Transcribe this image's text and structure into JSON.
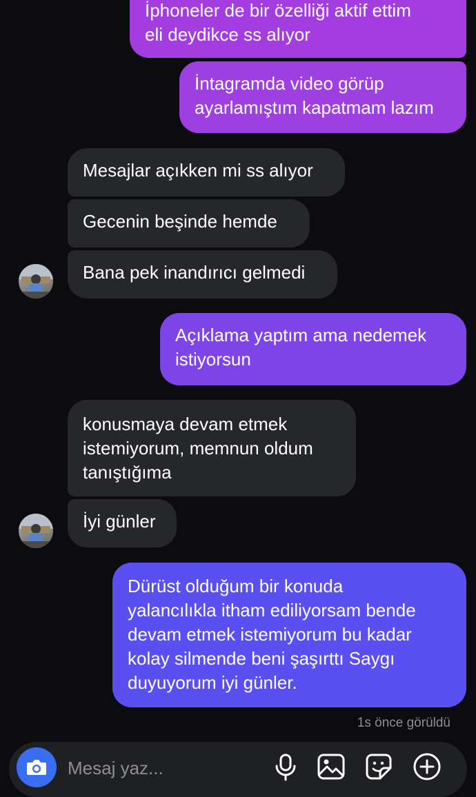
{
  "conversation": {
    "messages": [
      {
        "side": "sent",
        "text": "İphoneler de bir özelliği aktif ettim\neli deydikce ss alıyor"
      },
      {
        "side": "sent",
        "text": "İntagramda video görüp\nayarlamıştım kapatmam lazım"
      },
      {
        "side": "received",
        "text": "Mesajlar açıkken mi ss alıyor"
      },
      {
        "side": "received",
        "text": "Gecenin beşinde hemde"
      },
      {
        "side": "received",
        "text": "Bana pek inandırıcı gelmedi"
      },
      {
        "side": "sent",
        "text": "Açıklama yaptım ama nedemek\nistiyorsun"
      },
      {
        "side": "received",
        "text": "konusmaya devam etmek\nistemiyorum, memnun oldum\ntanıştığıma"
      },
      {
        "side": "received",
        "text": "İyi günler"
      },
      {
        "side": "sent",
        "text": "Dürüst olduğum bir konuda\nyalancılıkla itham ediliyorsam  bende\ndevam etmek istemiyorum bu kadar\nkolay silmende beni şaşırttı   Saygı\nduyuyorum iyi günler."
      }
    ],
    "seen_status": "1s önce görüldü"
  },
  "composer": {
    "placeholder": "Mesaj yaz...",
    "icons": [
      "camera-icon",
      "microphone-icon",
      "gallery-icon",
      "sticker-icon",
      "plus-icon"
    ]
  },
  "colors": {
    "background": "#0c0c10",
    "received_bubble": "#26272b",
    "sent_gradient_top": "#a43ddf",
    "sent_gradient_bottom": "#5a4ff0",
    "camera_button": "#3a6ef2",
    "seen_text": "#8e8e93"
  }
}
